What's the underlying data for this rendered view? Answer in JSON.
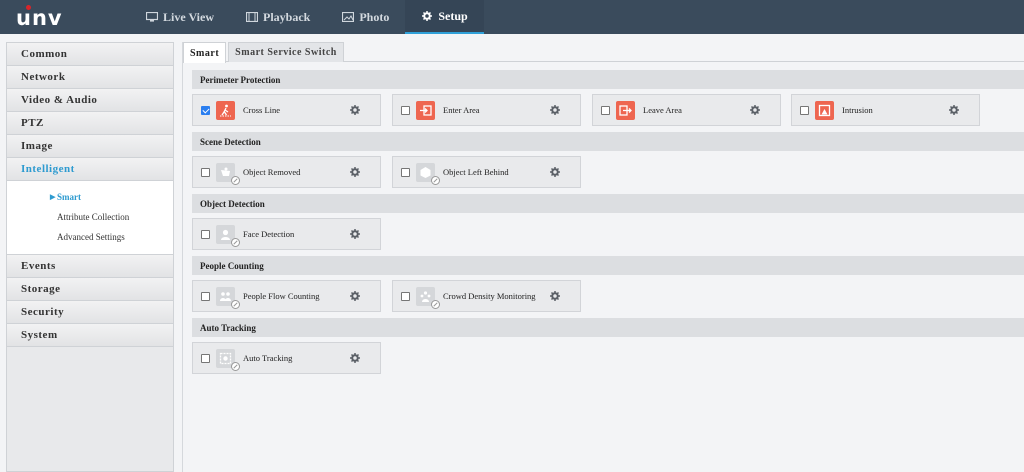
{
  "header": {
    "logo": "unv",
    "nav": [
      {
        "label": "Live View",
        "icon": "monitor-icon"
      },
      {
        "label": "Playback",
        "icon": "film-icon"
      },
      {
        "label": "Photo",
        "icon": "image-icon"
      },
      {
        "label": "Setup",
        "icon": "gear-icon",
        "active": true
      }
    ]
  },
  "sidebar": {
    "items_top": [
      "Common",
      "Network",
      "Video & Audio",
      "PTZ",
      "Image",
      "Intelligent"
    ],
    "sub_items": [
      "Smart",
      "Attribute Collection",
      "Advanced Settings"
    ],
    "items_bottom": [
      "Events",
      "Storage",
      "Security",
      "System"
    ]
  },
  "tabs": [
    "Smart",
    "Smart Service Switch"
  ],
  "sections": [
    {
      "title": "Perimeter Protection",
      "functions": [
        {
          "label": "Cross Line",
          "checked": true,
          "icon": "cross-line-icon",
          "color": "red"
        },
        {
          "label": "Enter Area",
          "checked": false,
          "icon": "enter-area-icon",
          "color": "red"
        },
        {
          "label": "Leave Area",
          "checked": false,
          "icon": "leave-area-icon",
          "color": "red"
        },
        {
          "label": "Intrusion",
          "checked": false,
          "icon": "intrusion-icon",
          "color": "red"
        }
      ]
    },
    {
      "title": "Scene Detection",
      "functions": [
        {
          "label": "Object Removed",
          "checked": false,
          "icon": "object-removed-icon",
          "color": "gray"
        },
        {
          "label": "Object Left Behind",
          "checked": false,
          "icon": "object-left-behind-icon",
          "color": "gray"
        }
      ]
    },
    {
      "title": "Object Detection",
      "functions": [
        {
          "label": "Face Detection",
          "checked": false,
          "icon": "face-detection-icon",
          "color": "gray"
        }
      ]
    },
    {
      "title": "People Counting",
      "functions": [
        {
          "label": "People Flow Counting",
          "checked": false,
          "icon": "people-flow-icon",
          "color": "gray"
        },
        {
          "label": "Crowd Density Monitoring",
          "checked": false,
          "icon": "crowd-density-icon",
          "color": "gray"
        }
      ]
    },
    {
      "title": "Auto Tracking",
      "functions": [
        {
          "label": "Auto Tracking",
          "checked": false,
          "icon": "auto-tracking-icon",
          "color": "gray"
        }
      ]
    }
  ],
  "colors": {
    "header_bg": "#3a4b5c",
    "accent": "#2e9bd0",
    "active_icon": "#ee6650",
    "checkbox_checked": "#2a7ef0"
  }
}
